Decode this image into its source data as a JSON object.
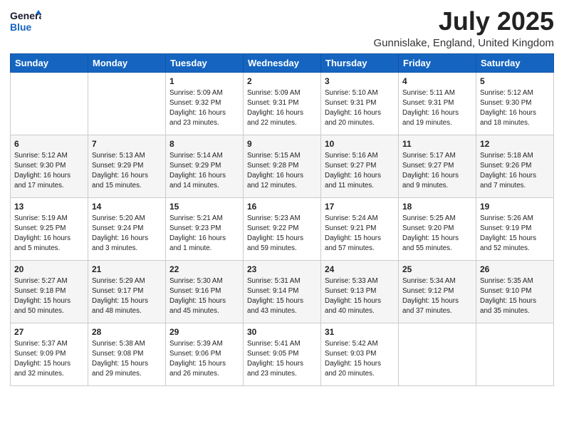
{
  "header": {
    "logo_general": "General",
    "logo_blue": "Blue",
    "month": "July 2025",
    "location": "Gunnislake, England, United Kingdom"
  },
  "days_of_week": [
    "Sunday",
    "Monday",
    "Tuesday",
    "Wednesday",
    "Thursday",
    "Friday",
    "Saturday"
  ],
  "weeks": [
    [
      {
        "day": "",
        "info": ""
      },
      {
        "day": "",
        "info": ""
      },
      {
        "day": "1",
        "info": "Sunrise: 5:09 AM\nSunset: 9:32 PM\nDaylight: 16 hours and 23 minutes."
      },
      {
        "day": "2",
        "info": "Sunrise: 5:09 AM\nSunset: 9:31 PM\nDaylight: 16 hours and 22 minutes."
      },
      {
        "day": "3",
        "info": "Sunrise: 5:10 AM\nSunset: 9:31 PM\nDaylight: 16 hours and 20 minutes."
      },
      {
        "day": "4",
        "info": "Sunrise: 5:11 AM\nSunset: 9:31 PM\nDaylight: 16 hours and 19 minutes."
      },
      {
        "day": "5",
        "info": "Sunrise: 5:12 AM\nSunset: 9:30 PM\nDaylight: 16 hours and 18 minutes."
      }
    ],
    [
      {
        "day": "6",
        "info": "Sunrise: 5:12 AM\nSunset: 9:30 PM\nDaylight: 16 hours and 17 minutes."
      },
      {
        "day": "7",
        "info": "Sunrise: 5:13 AM\nSunset: 9:29 PM\nDaylight: 16 hours and 15 minutes."
      },
      {
        "day": "8",
        "info": "Sunrise: 5:14 AM\nSunset: 9:29 PM\nDaylight: 16 hours and 14 minutes."
      },
      {
        "day": "9",
        "info": "Sunrise: 5:15 AM\nSunset: 9:28 PM\nDaylight: 16 hours and 12 minutes."
      },
      {
        "day": "10",
        "info": "Sunrise: 5:16 AM\nSunset: 9:27 PM\nDaylight: 16 hours and 11 minutes."
      },
      {
        "day": "11",
        "info": "Sunrise: 5:17 AM\nSunset: 9:27 PM\nDaylight: 16 hours and 9 minutes."
      },
      {
        "day": "12",
        "info": "Sunrise: 5:18 AM\nSunset: 9:26 PM\nDaylight: 16 hours and 7 minutes."
      }
    ],
    [
      {
        "day": "13",
        "info": "Sunrise: 5:19 AM\nSunset: 9:25 PM\nDaylight: 16 hours and 5 minutes."
      },
      {
        "day": "14",
        "info": "Sunrise: 5:20 AM\nSunset: 9:24 PM\nDaylight: 16 hours and 3 minutes."
      },
      {
        "day": "15",
        "info": "Sunrise: 5:21 AM\nSunset: 9:23 PM\nDaylight: 16 hours and 1 minute."
      },
      {
        "day": "16",
        "info": "Sunrise: 5:23 AM\nSunset: 9:22 PM\nDaylight: 15 hours and 59 minutes."
      },
      {
        "day": "17",
        "info": "Sunrise: 5:24 AM\nSunset: 9:21 PM\nDaylight: 15 hours and 57 minutes."
      },
      {
        "day": "18",
        "info": "Sunrise: 5:25 AM\nSunset: 9:20 PM\nDaylight: 15 hours and 55 minutes."
      },
      {
        "day": "19",
        "info": "Sunrise: 5:26 AM\nSunset: 9:19 PM\nDaylight: 15 hours and 52 minutes."
      }
    ],
    [
      {
        "day": "20",
        "info": "Sunrise: 5:27 AM\nSunset: 9:18 PM\nDaylight: 15 hours and 50 minutes."
      },
      {
        "day": "21",
        "info": "Sunrise: 5:29 AM\nSunset: 9:17 PM\nDaylight: 15 hours and 48 minutes."
      },
      {
        "day": "22",
        "info": "Sunrise: 5:30 AM\nSunset: 9:16 PM\nDaylight: 15 hours and 45 minutes."
      },
      {
        "day": "23",
        "info": "Sunrise: 5:31 AM\nSunset: 9:14 PM\nDaylight: 15 hours and 43 minutes."
      },
      {
        "day": "24",
        "info": "Sunrise: 5:33 AM\nSunset: 9:13 PM\nDaylight: 15 hours and 40 minutes."
      },
      {
        "day": "25",
        "info": "Sunrise: 5:34 AM\nSunset: 9:12 PM\nDaylight: 15 hours and 37 minutes."
      },
      {
        "day": "26",
        "info": "Sunrise: 5:35 AM\nSunset: 9:10 PM\nDaylight: 15 hours and 35 minutes."
      }
    ],
    [
      {
        "day": "27",
        "info": "Sunrise: 5:37 AM\nSunset: 9:09 PM\nDaylight: 15 hours and 32 minutes."
      },
      {
        "day": "28",
        "info": "Sunrise: 5:38 AM\nSunset: 9:08 PM\nDaylight: 15 hours and 29 minutes."
      },
      {
        "day": "29",
        "info": "Sunrise: 5:39 AM\nSunset: 9:06 PM\nDaylight: 15 hours and 26 minutes."
      },
      {
        "day": "30",
        "info": "Sunrise: 5:41 AM\nSunset: 9:05 PM\nDaylight: 15 hours and 23 minutes."
      },
      {
        "day": "31",
        "info": "Sunrise: 5:42 AM\nSunset: 9:03 PM\nDaylight: 15 hours and 20 minutes."
      },
      {
        "day": "",
        "info": ""
      },
      {
        "day": "",
        "info": ""
      }
    ]
  ]
}
